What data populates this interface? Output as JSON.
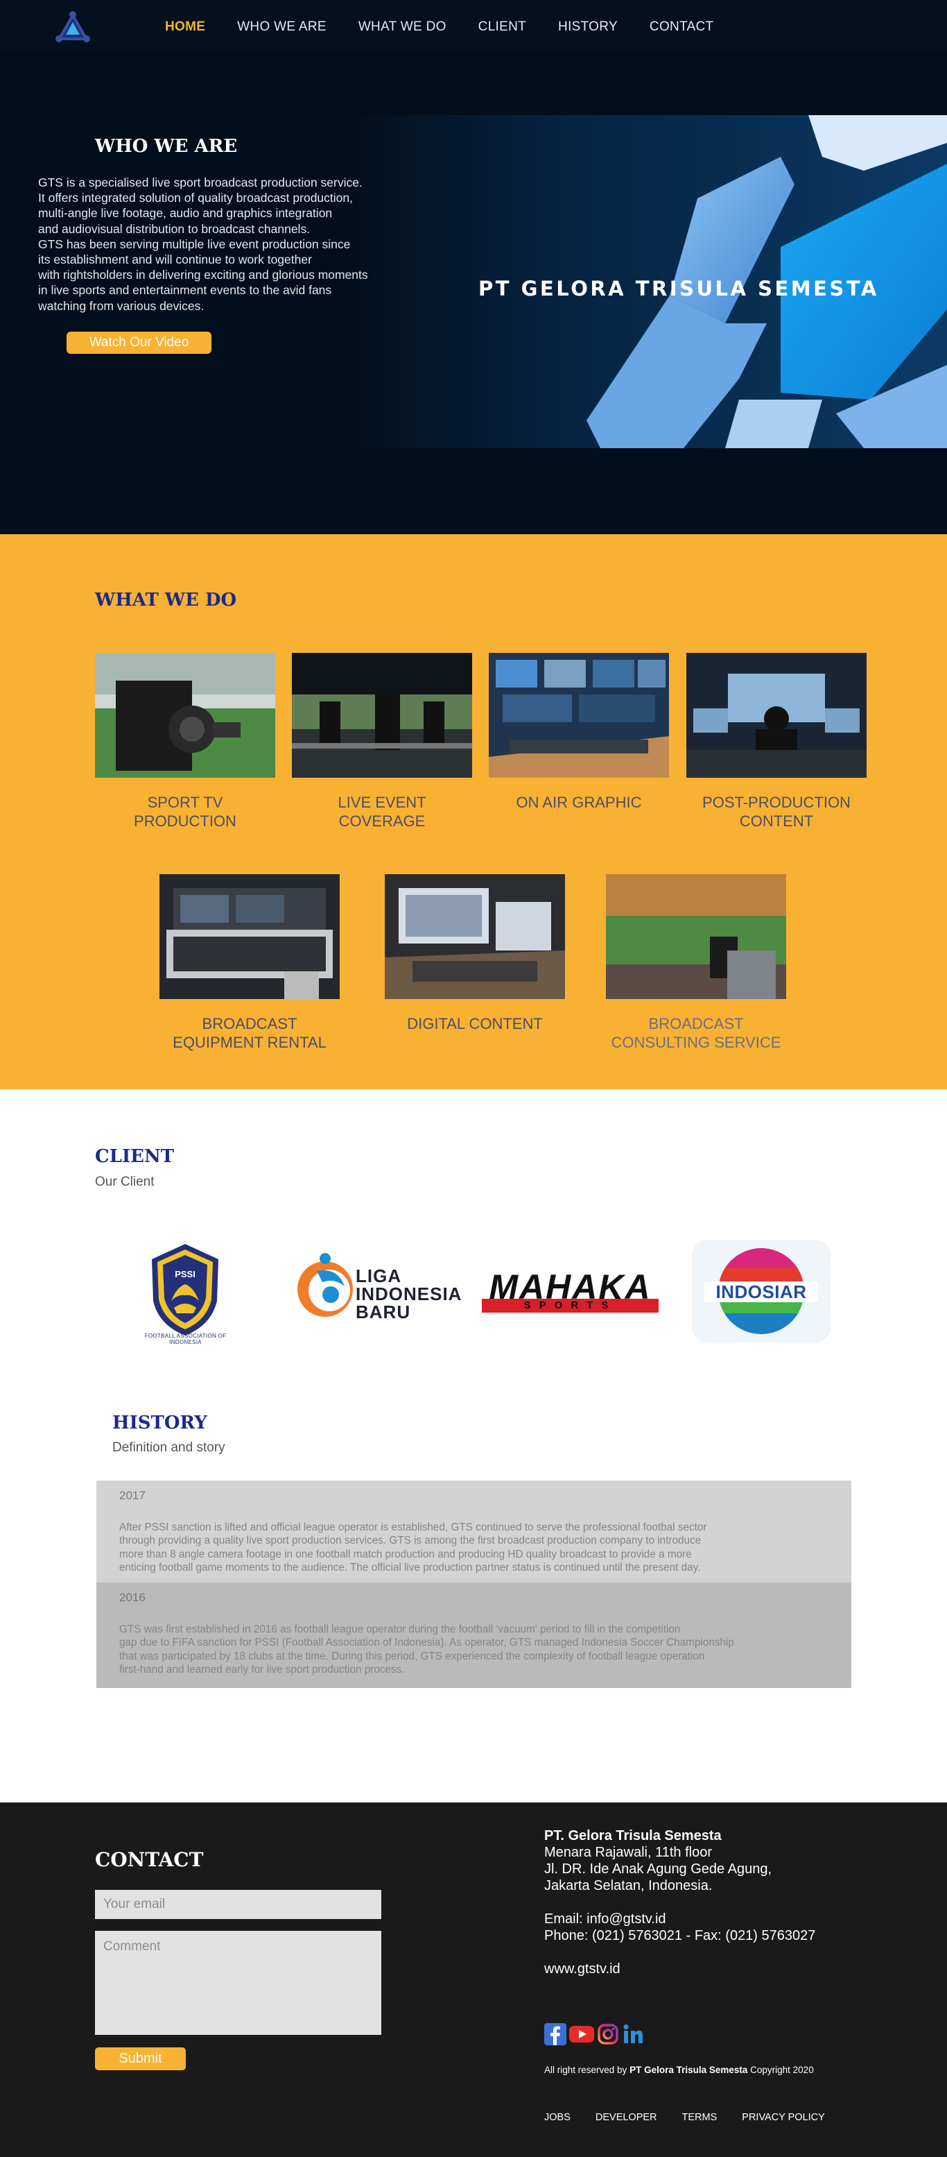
{
  "nav": {
    "items": [
      {
        "label": "HOME",
        "active": true
      },
      {
        "label": "WHO WE ARE"
      },
      {
        "label": "WHAT WE DO"
      },
      {
        "label": "CLIENT"
      },
      {
        "label": "HISTORY"
      },
      {
        "label": "CONTACT"
      }
    ],
    "logo_icon": "triangle-logo-icon"
  },
  "hero": {
    "title": "WHO WE ARE",
    "description": "GTS is a specialised live sport broadcast production service.\nIt offers integrated solution of quality broadcast production,\nmulti-angle live footage, audio and graphics integration\nand audiovisual distribution to broadcast channels.\nGTS has been serving multiple live event production since\nits establishment and will continue to work together\nwith rightsholders in delivering exciting and glorious moments\nin live sports and entertainment events  to the avid fans\nwatching from various devices.",
    "button_label": "Watch Our Video",
    "brand_text": "PT GELORA TRISULA SEMESTA"
  },
  "services": {
    "title": "WHAT WE DO",
    "items": [
      {
        "label": "SPORT TV\nPRODUCTION",
        "line1": "SPORT TV",
        "line2": "PRODUCTION"
      },
      {
        "line1": "LIVE EVENT",
        "line2": "COVERAGE"
      },
      {
        "line1": "ON AIR GRAPHIC",
        "line2": ""
      },
      {
        "line1": "POST-PRODUCTION",
        "line2": "CONTENT"
      },
      {
        "line1": "BROADCAST",
        "line2": "EQUIPMENT RENTAL"
      },
      {
        "line1": "DIGITAL CONTENT",
        "line2": ""
      },
      {
        "line1": "BROADCAST",
        "line2": "CONSULTING SERVICE"
      }
    ]
  },
  "clients": {
    "title": "CLIENT",
    "subtitle": "Our Client",
    "logos": {
      "pssi": {
        "top": "PSSI",
        "ring": "FOOTBALL ASSOCIATION OF INDONESIA"
      },
      "liga": {
        "line1": "LIGA",
        "line2": "INDONESIA",
        "line3": "BARU"
      },
      "mahaka": {
        "name": "MAHAKA",
        "sub": "SPORTS"
      },
      "indosiar": {
        "name": "INDOSIAR"
      }
    }
  },
  "history": {
    "title": "HISTORY",
    "subtitle": "Definition and story",
    "entries": [
      {
        "year": "2017",
        "text": "After PSSI sanction is lifted and official league operator is established, GTS continued to serve the professional footbal sector\nthrough providing a quality live sport production services. GTS is among the first broadcast production company to introduce\nmore than 8 angle camera footage in one football match production and producing HD quality broadcast to provide a more\nenticing football game moments to the audience. The official live production partner status is continued until the present day."
      },
      {
        "year": "2016",
        "text": "GTS was first established in 2016 as football league operator during the football 'vacuum' period to fill in the competition\ngap due to FIFA sanction for PSSI (Football Association of Indonesia). As operator, GTS managed Indonesia Soccer Championship\n that was participated by 18 clubs at the time. During this period, GTS experienced the complexity of football league operation\nfirst-hand and learned early for live sport production process."
      }
    ]
  },
  "footer": {
    "contact_title": "CONTACT",
    "email_placeholder": "Your email",
    "comment_placeholder": "Comment",
    "submit_label": "Submit",
    "company_name": "PT. Gelora Trisula Semesta",
    "address": "Menara Rajawali, 11th floor\nJl. DR. Ide Anak Agung Gede Agung,\nJakarta Selatan, Indonesia.",
    "email": "Email: info@gtstv.id",
    "phone": "Phone: (021) 5763021 - Fax: (021) 5763027",
    "website": "www.gtstv.id",
    "socials": [
      "facebook-icon",
      "youtube-icon",
      "instagram-icon",
      "linkedin-icon"
    ],
    "rights_prefix": "All right reserved by ",
    "rights_company": "PT Gelora Trisula Semesta",
    "rights_suffix": " Copyright 2020",
    "links": [
      "JOBS",
      "DEVELOPER",
      "TERMS",
      "PRIVACY POLICY"
    ]
  },
  "colors": {
    "accent": "#f7b233",
    "heading_blue": "#1c2a8a",
    "hero_bg": "#020e1b",
    "footer_bg": "#1a1a1a"
  }
}
